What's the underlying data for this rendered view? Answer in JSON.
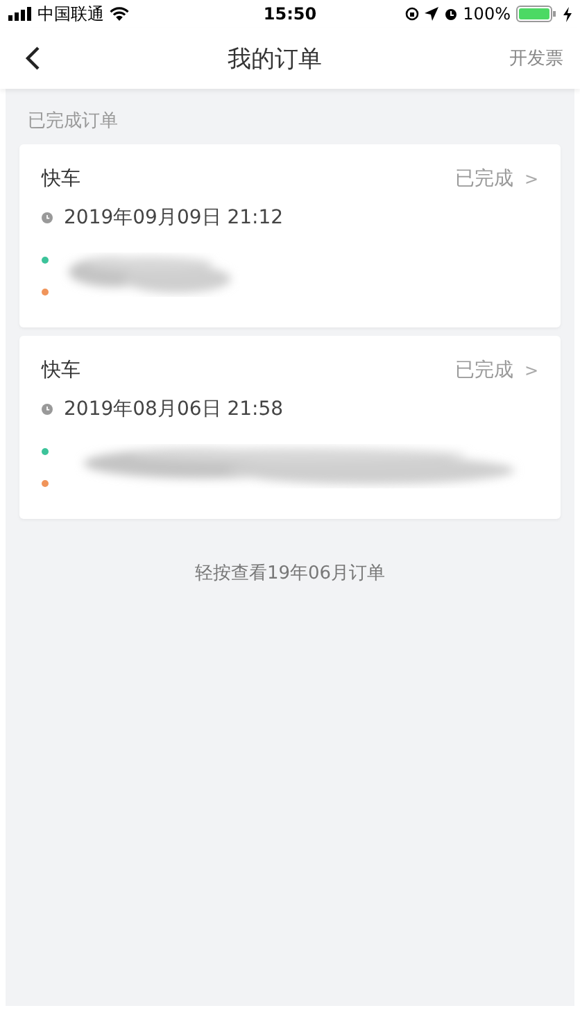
{
  "status_bar": {
    "carrier": "中国联通",
    "time": "15:50",
    "battery": "100%"
  },
  "nav": {
    "title": "我的订单",
    "action": "开发票"
  },
  "section_title": "已完成订单",
  "orders": [
    {
      "type": "快车",
      "status": "已完成",
      "chevron": ">",
      "time": "2019年09月09日 21:12",
      "stops": [
        {
          "color": "#3cc39a"
        },
        {
          "color": "#f0945a"
        }
      ]
    },
    {
      "type": "快车",
      "status": "已完成",
      "chevron": ">",
      "time": "2019年08月06日 21:58",
      "stops": [
        {
          "color": "#3cc39a"
        },
        {
          "color": "#f0945a"
        }
      ]
    }
  ],
  "more_link": "轻按查看19年06月订单"
}
